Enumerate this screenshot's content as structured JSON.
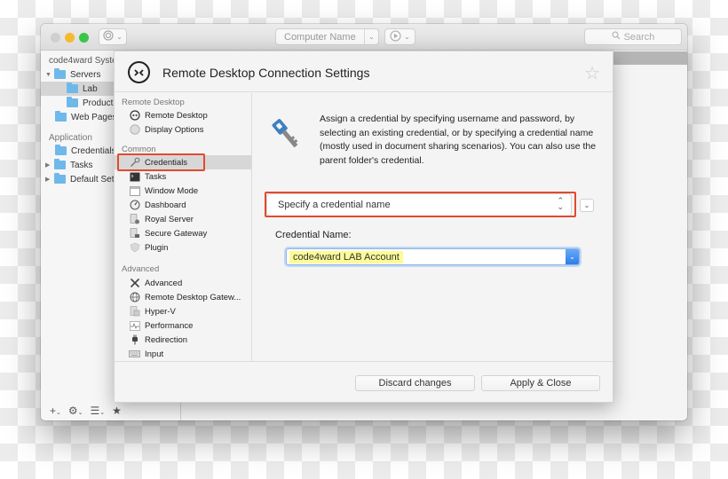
{
  "toolbar": {
    "computer_name_placeholder": "Computer Name",
    "search_placeholder": "Search",
    "icons": {
      "logo": "royal-logo-icon",
      "play": "play-circle-icon",
      "search": "magnifier-icon",
      "chevron": "chevron-down-icon"
    }
  },
  "tree": {
    "root": "code4ward Syste",
    "items": [
      {
        "label": "Servers",
        "expanded": true
      },
      {
        "label": "Lab",
        "selected": true
      },
      {
        "label": "Producti"
      },
      {
        "label": "Web Pages"
      }
    ],
    "application_header": "Application",
    "app_items": [
      {
        "label": "Credentials"
      },
      {
        "label": "Tasks",
        "collapsed": true
      },
      {
        "label": "Default Sett",
        "collapsed": true
      }
    ]
  },
  "bottom_bar": {
    "add": "+",
    "gear": "⚙",
    "list": "☰",
    "star": "★",
    "chev": "⌄"
  },
  "dialog": {
    "title": "Remote Desktop Connection Settings",
    "icon_glyph": "›‹",
    "favorite": "☆",
    "nav": {
      "sections": [
        {
          "header": "Remote Desktop",
          "items": [
            "Remote Desktop",
            "Display Options"
          ]
        },
        {
          "header": "Common",
          "items": [
            "Credentials",
            "Tasks",
            "Window Mode",
            "Dashboard",
            "Royal Server",
            "Secure Gateway",
            "Plugin"
          ]
        },
        {
          "header": "Advanced",
          "items": [
            "Advanced",
            "Remote Desktop Gatew...",
            "Hyper-V",
            "Performance",
            "Redirection",
            "Input"
          ]
        }
      ],
      "selected": "Credentials"
    },
    "content": {
      "description": "Assign a credential by specifying username and password, by selecting an existing credential, or by specifying a credential name (mostly used in document sharing scenarios). You can also use the parent folder's credential.",
      "mode_select": "Specify a credential name",
      "credential_name_label": "Credential Name:",
      "credential_name_value": "code4ward LAB Account"
    },
    "footer": {
      "discard": "Discard changes",
      "apply": "Apply & Close"
    }
  },
  "colors": {
    "highlight_border": "#e2492f",
    "folder": "#6fb8ea",
    "combo_button": "#2c7ee8",
    "text_highlight": "#fdfb98",
    "key_blue": "#3f7fc1"
  }
}
